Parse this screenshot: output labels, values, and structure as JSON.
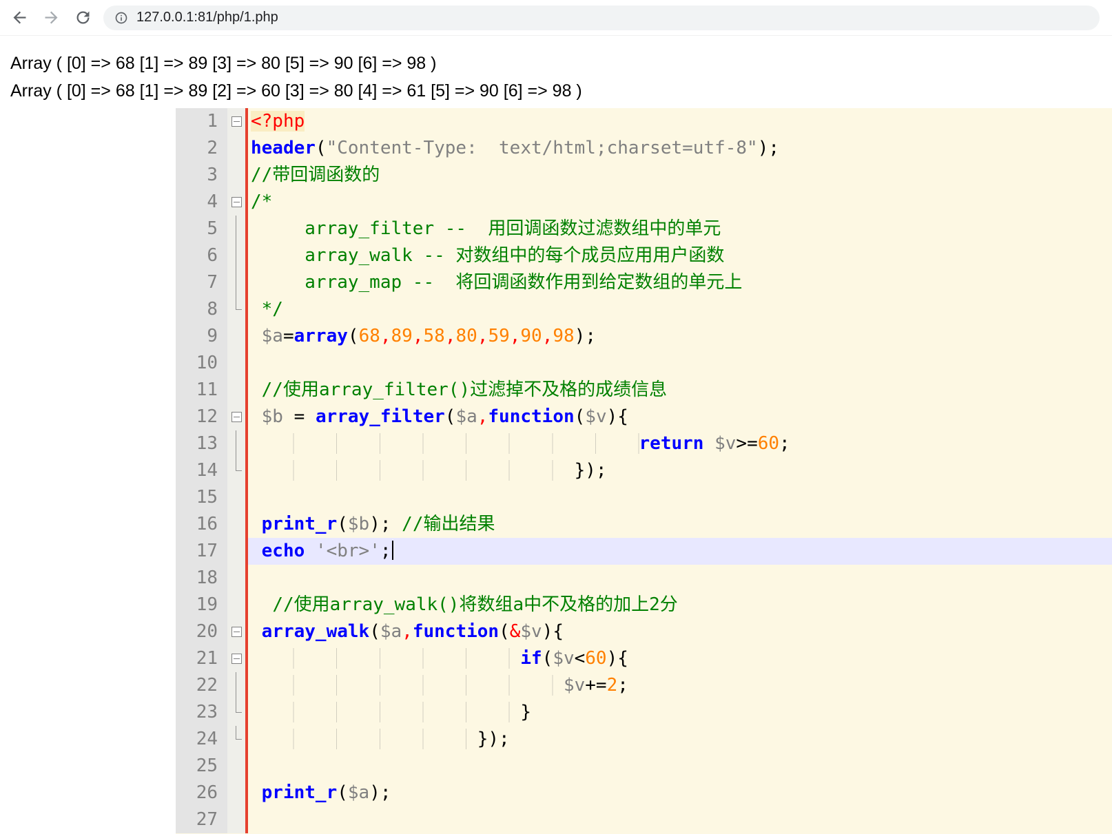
{
  "browser": {
    "url": "127.0.0.1:81/php/1.php",
    "icons": {
      "back": "arrow-left",
      "forward": "arrow-right",
      "reload": "refresh",
      "page_info": "info-circle"
    }
  },
  "output_lines": [
    "Array ( [0] => 68 [1] => 89 [3] => 80 [5] => 90 [6] => 98 )",
    "Array ( [0] => 68 [1] => 89 [2] => 60 [3] => 80 [4] => 61 [5] => 90 [6] => 98 )"
  ],
  "editor": {
    "current_line": 17,
    "colors": {
      "background": "#FDF8E3",
      "gutter_bg": "#E4E4E4",
      "fold_bg": "#EFEFEA",
      "line_number": "#808080",
      "keyword": "#0000FF",
      "comment": "#008000",
      "string": "#808080",
      "number": "#FF8000",
      "variable": "#808080",
      "default": "#000000",
      "phptag": "#FF0000",
      "phptag_bg": "#FAEDC3",
      "red": "#FF0000",
      "current_line_bg": "#E8E8FF",
      "change_bar": "#E5402F"
    },
    "lines": [
      {
        "n": 1,
        "fold": "box",
        "tokens": [
          [
            "t",
            "<?php"
          ]
        ]
      },
      {
        "n": 2,
        "fold": "none",
        "tokens": [
          [
            "k",
            "header"
          ],
          [
            "d",
            "("
          ],
          [
            "s",
            "\"Content-Type:  text/html;charset=utf-8\""
          ],
          [
            "d",
            ");"
          ]
        ]
      },
      {
        "n": 3,
        "fold": "none",
        "tokens": [
          [
            "c",
            "//带回调函数的"
          ]
        ]
      },
      {
        "n": 4,
        "fold": "box",
        "tokens": [
          [
            "c",
            "/*"
          ]
        ]
      },
      {
        "n": 5,
        "fold": "line",
        "tokens": [
          [
            "c",
            "     array_filter --  用回调函数过滤数组中的单元"
          ]
        ]
      },
      {
        "n": 6,
        "fold": "line",
        "tokens": [
          [
            "c",
            "     array_walk -- 对数组中的每个成员应用用户函数"
          ]
        ]
      },
      {
        "n": 7,
        "fold": "line",
        "tokens": [
          [
            "c",
            "     array_map --  将回调函数作用到给定数组的单元上"
          ]
        ]
      },
      {
        "n": 8,
        "fold": "end",
        "tokens": [
          [
            "c",
            " */"
          ]
        ]
      },
      {
        "n": 9,
        "fold": "none",
        "tokens": [
          [
            "d",
            " "
          ],
          [
            "v",
            "$a"
          ],
          [
            "d",
            "="
          ],
          [
            "k",
            "array"
          ],
          [
            "d",
            "("
          ],
          [
            "n",
            "68"
          ],
          [
            "r",
            ","
          ],
          [
            "n",
            "89"
          ],
          [
            "r",
            ","
          ],
          [
            "n",
            "58"
          ],
          [
            "r",
            ","
          ],
          [
            "n",
            "80"
          ],
          [
            "r",
            ","
          ],
          [
            "n",
            "59"
          ],
          [
            "r",
            ","
          ],
          [
            "n",
            "90"
          ],
          [
            "r",
            ","
          ],
          [
            "n",
            "98"
          ],
          [
            "d",
            ");"
          ]
        ]
      },
      {
        "n": 10,
        "fold": "none",
        "tokens": []
      },
      {
        "n": 11,
        "fold": "none",
        "tokens": [
          [
            "d",
            " "
          ],
          [
            "c",
            "//使用array_filter()过滤掉不及格的成绩信息"
          ]
        ]
      },
      {
        "n": 12,
        "fold": "box",
        "tokens": [
          [
            "d",
            " "
          ],
          [
            "v",
            "$b"
          ],
          [
            "d",
            " = "
          ],
          [
            "k",
            "array_filter"
          ],
          [
            "d",
            "("
          ],
          [
            "v",
            "$a"
          ],
          [
            "r",
            ","
          ],
          [
            "k",
            "function"
          ],
          [
            "d",
            "("
          ],
          [
            "v",
            "$v"
          ],
          [
            "d",
            "){"
          ]
        ]
      },
      {
        "n": 13,
        "fold": "line",
        "tokens": [
          [
            "w",
            "                                    "
          ],
          [
            "k",
            "return"
          ],
          [
            "d",
            " "
          ],
          [
            "v",
            "$v"
          ],
          [
            "d",
            ">="
          ],
          [
            "n",
            "60"
          ],
          [
            "d",
            ";"
          ]
        ]
      },
      {
        "n": 14,
        "fold": "end",
        "tokens": [
          [
            "w",
            "                              "
          ],
          [
            "d",
            "});"
          ]
        ]
      },
      {
        "n": 15,
        "fold": "none",
        "tokens": []
      },
      {
        "n": 16,
        "fold": "none",
        "tokens": [
          [
            "d",
            " "
          ],
          [
            "k",
            "print_r"
          ],
          [
            "d",
            "("
          ],
          [
            "v",
            "$b"
          ],
          [
            "d",
            "); "
          ],
          [
            "c",
            "//输出结果"
          ]
        ]
      },
      {
        "n": 17,
        "fold": "none",
        "caret": true,
        "tokens": [
          [
            "d",
            " "
          ],
          [
            "k",
            "echo"
          ],
          [
            "d",
            " "
          ],
          [
            "s",
            "'<br>'"
          ],
          [
            "d",
            ";"
          ]
        ]
      },
      {
        "n": 18,
        "fold": "none",
        "tokens": []
      },
      {
        "n": 19,
        "fold": "none",
        "tokens": [
          [
            "d",
            "  "
          ],
          [
            "c",
            "//使用array_walk()将数组a中不及格的加上2分"
          ]
        ]
      },
      {
        "n": 20,
        "fold": "box",
        "tokens": [
          [
            "d",
            " "
          ],
          [
            "k",
            "array_walk"
          ],
          [
            "d",
            "("
          ],
          [
            "v",
            "$a"
          ],
          [
            "r",
            ","
          ],
          [
            "k",
            "function"
          ],
          [
            "d",
            "("
          ],
          [
            "r",
            "&"
          ],
          [
            "v",
            "$v"
          ],
          [
            "d",
            "){"
          ]
        ]
      },
      {
        "n": 21,
        "fold": "box",
        "tokens": [
          [
            "w",
            "                         "
          ],
          [
            "k",
            "if"
          ],
          [
            "d",
            "("
          ],
          [
            "v",
            "$v"
          ],
          [
            "d",
            "<"
          ],
          [
            "n",
            "60"
          ],
          [
            "d",
            "){"
          ]
        ]
      },
      {
        "n": 22,
        "fold": "line",
        "tokens": [
          [
            "w",
            "                             "
          ],
          [
            "v",
            "$v"
          ],
          [
            "d",
            "+="
          ],
          [
            "n",
            "2"
          ],
          [
            "d",
            ";"
          ]
        ]
      },
      {
        "n": 23,
        "fold": "end",
        "tokens": [
          [
            "w",
            "                         "
          ],
          [
            "d",
            "}"
          ]
        ]
      },
      {
        "n": 24,
        "fold": "end",
        "tokens": [
          [
            "w",
            "                     "
          ],
          [
            "d",
            "});"
          ]
        ]
      },
      {
        "n": 25,
        "fold": "none",
        "tokens": []
      },
      {
        "n": 26,
        "fold": "none",
        "tokens": [
          [
            "d",
            " "
          ],
          [
            "k",
            "print_r"
          ],
          [
            "d",
            "("
          ],
          [
            "v",
            "$a"
          ],
          [
            "d",
            ");"
          ]
        ]
      },
      {
        "n": 27,
        "fold": "none",
        "tokens": []
      }
    ]
  }
}
